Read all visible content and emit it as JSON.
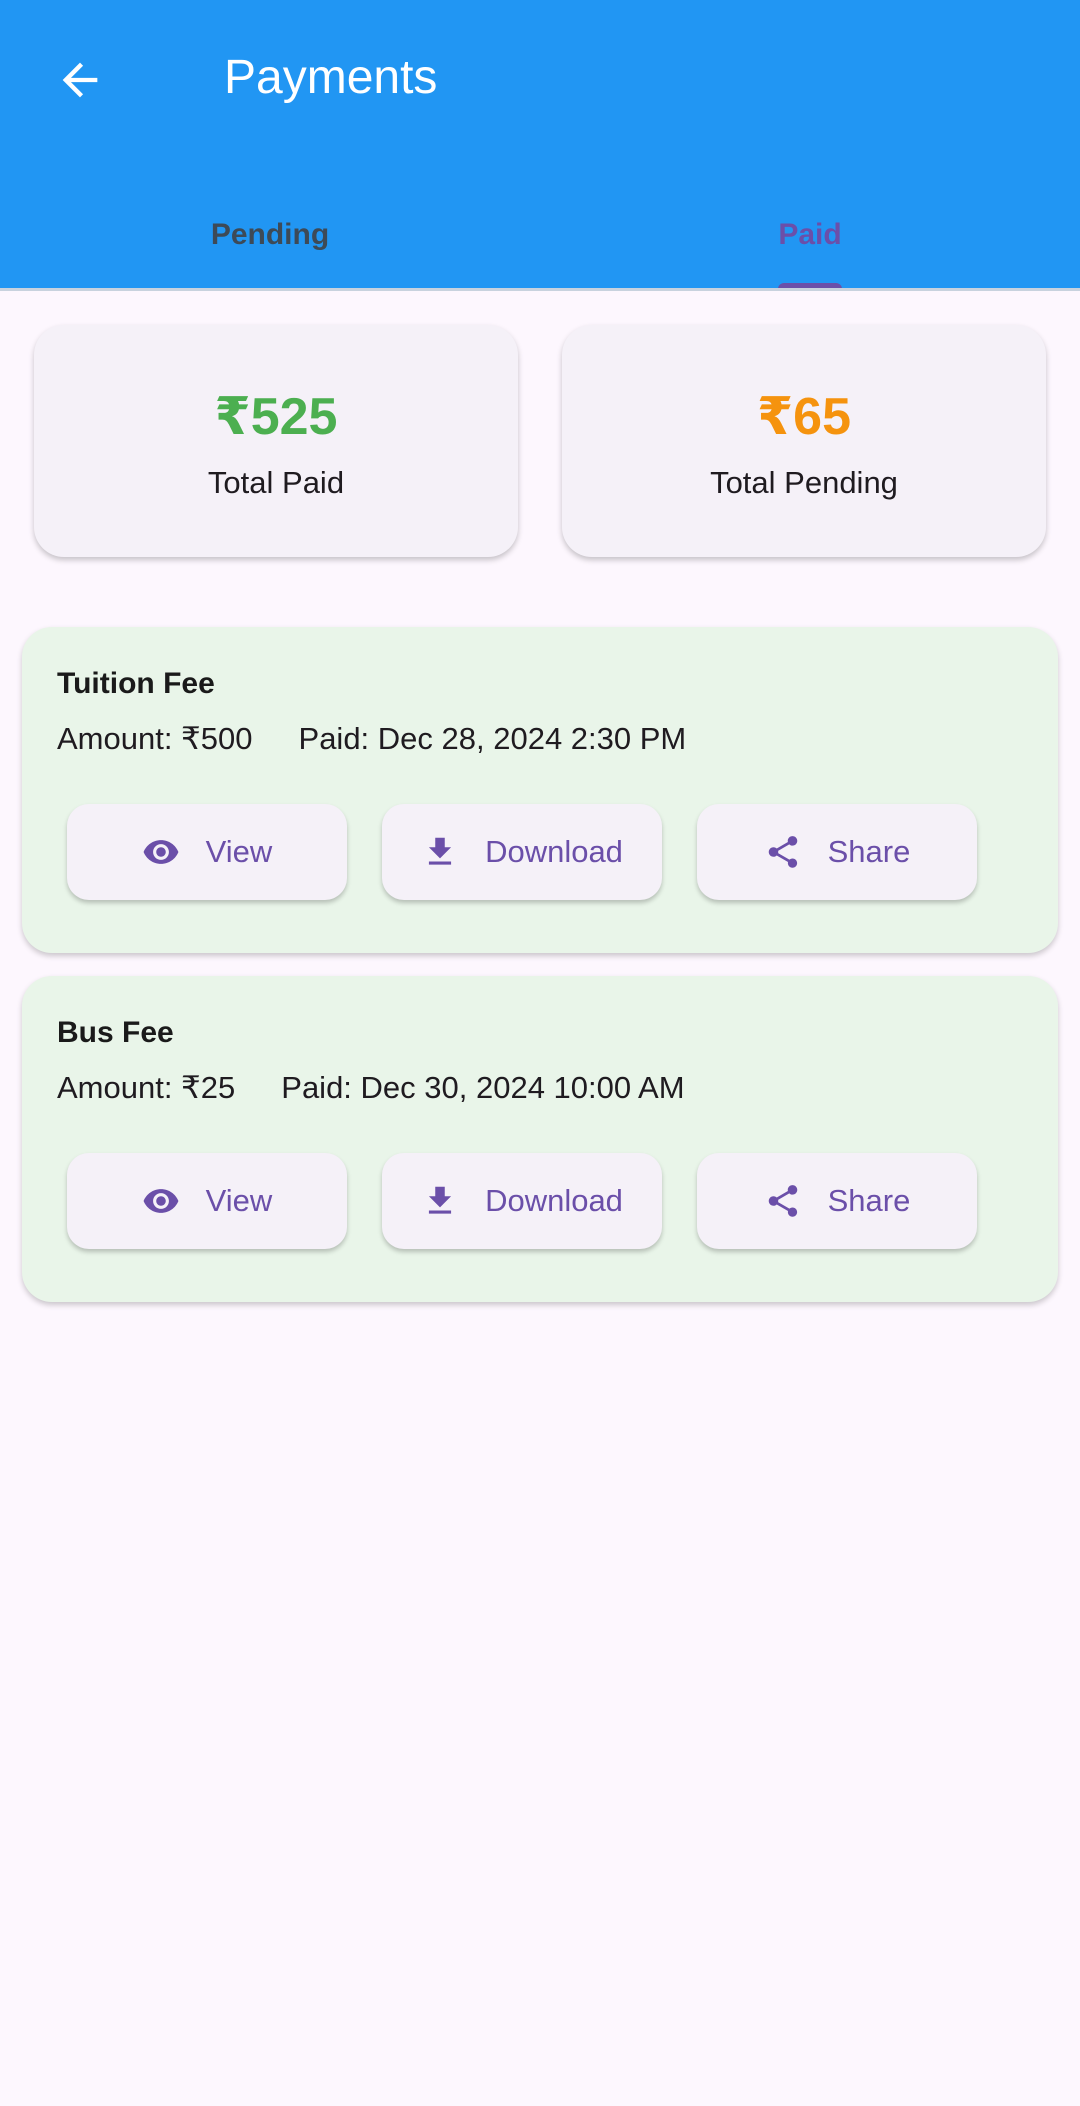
{
  "header": {
    "title": "Payments"
  },
  "tabs": [
    {
      "label": "Pending",
      "active": false
    },
    {
      "label": "Paid",
      "active": true
    }
  ],
  "summary": {
    "paid": {
      "amount": "₹525",
      "label": "Total Paid",
      "color": "#4caf50"
    },
    "pending": {
      "amount": "₹65",
      "label": "Total Pending",
      "color": "#f5930e"
    }
  },
  "payments": [
    {
      "name": "Tuition Fee",
      "amount": "Amount: ₹500",
      "paid": "Paid: Dec 28, 2024 2:30 PM",
      "actions": {
        "view": "View",
        "download": "Download",
        "share": "Share"
      }
    },
    {
      "name": "Bus Fee",
      "amount": "Amount: ₹25",
      "paid": "Paid: Dec 30, 2024 10:00 AM",
      "actions": {
        "view": "View",
        "download": "Download",
        "share": "Share"
      }
    }
  ],
  "icons": {
    "back": "arrow-back-icon",
    "view": "eye-icon",
    "download": "download-icon",
    "share": "share-icon"
  },
  "colors": {
    "appbar": "#2196f3",
    "accent": "#6b4fa9",
    "card_background": "#e9f5e9",
    "page_background": "#fdf7fe"
  }
}
